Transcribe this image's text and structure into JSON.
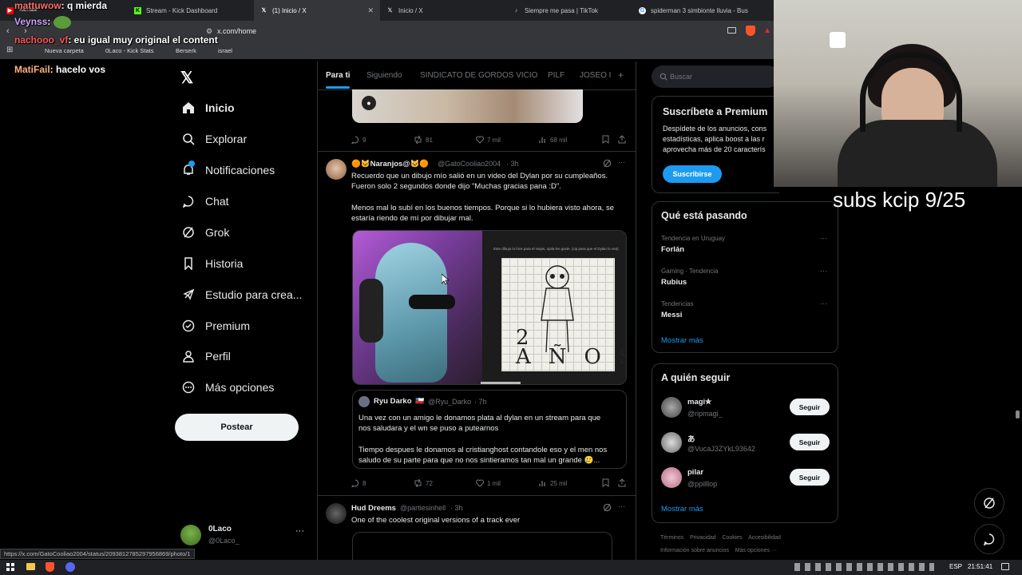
{
  "tabs": [
    {
      "label": "YouTube",
      "icon": "youtube-icon",
      "color": "#ff0000"
    },
    {
      "label": "Stream - Kick Dashboard",
      "icon": "kick-icon",
      "color": "#53fc18"
    },
    {
      "label": "(1) Inicio / X",
      "icon": "x-icon",
      "color": "#ffffff"
    },
    {
      "label": "Inicio / X",
      "icon": "x-icon",
      "color": "#ffffff"
    },
    {
      "label": "Siempre me pasa | TikTok",
      "icon": "tiktok-icon",
      "color": "#ffffff"
    },
    {
      "label": "spiderman 3 simbionte lluvia - Bus",
      "icon": "google-icon",
      "color": "#4285f4"
    }
  ],
  "address": {
    "url": "x.com/home"
  },
  "bookmarks": [
    "Nueva carpeta",
    "0Laco - Kick Stats",
    "Berserk",
    "israel"
  ],
  "chat": [
    {
      "user": "mattuwow",
      "text": ": q mierda"
    },
    {
      "user": "Veynss",
      "text": ":"
    },
    {
      "user": "nachooo_vf",
      "text": ": eu igual muy original el content"
    },
    {
      "user": "MatiFail",
      "text": ": hacelo vos"
    }
  ],
  "nav": {
    "items": [
      "Inicio",
      "Explorar",
      "Notificaciones",
      "Chat",
      "Grok",
      "Historia",
      "Estudio para crea...",
      "Premium",
      "Perfil",
      "Más opciones"
    ],
    "post": "Postear",
    "account_name": "0Laco",
    "account_handle": "@0Laco_",
    "status_url": "https://x.com/GatoCooliao2004/status/2093812785297956869/photo/1"
  },
  "feed": {
    "tabs": [
      "Para ti",
      "Siguiendo",
      "SINDICATO DE GORDOS VICIO",
      "PILF",
      "JOSEO I"
    ],
    "prev_actions": {
      "replies": "9",
      "reposts": "81",
      "likes": "7 mil",
      "views": "68 mil"
    },
    "post1": {
      "name": "🟠🐱Naranjos@🐱🟠",
      "handle": "@GatoCooliao2004",
      "time": "· 3h",
      "line1": "Recuerdo que un dibujo mío salió en un video del Dylan por su cumpleaños.",
      "line2": "Fueron solo 2 segundos donde dijo \"Muchas gracias pana :D\".",
      "line3": "Menos mal lo subí en los buenos tiempos. Porque si lo hubiera visto ahora, se",
      "line4": "estaría riendo de mí por dibujar mal.",
      "drawing_text": "2 AÑOS",
      "overlay_text": "Este dibujo lo hice para el viejas, ojala les guste. (Up para que el Dylan lo vea)",
      "quote": {
        "name": "Ryu Darko",
        "flag": "🇨🇱",
        "handle": "@Ryu_Darko",
        "time": "· 7h",
        "line1": "Una vez con un amigo le donamos plata al dylan en un stream para que",
        "line2": "nos saludara y el wn se puso a putearnos",
        "line3": "Tiempo despues le donamos al cristianghost contandole eso y el men nos",
        "line4": "saludo de su parte para que no nos sintieramos tan mal un grande 🥲..."
      },
      "actions": {
        "replies": "8",
        "reposts": "72",
        "likes": "1 mil",
        "views": "25 mil"
      }
    },
    "post2": {
      "name": "Hud Dreems",
      "handle": "@partiesinhell",
      "time": "· 3h",
      "text": "One of the coolest original versions of a track ever"
    }
  },
  "right": {
    "search_placeholder": "Buscar",
    "premium": {
      "title": "Suscríbete a Premium",
      "l1": "Despídete de los anuncios, cons",
      "l2": "estadísticas, aplica boost a las r",
      "l3": "aprovecha más de 20 caracterís",
      "button": "Suscribirse"
    },
    "trends_title": "Qué está pasando",
    "trends": [
      {
        "context": "Tendencia en Uruguay",
        "name": "Forlán"
      },
      {
        "context": "Gaming · Tendencia",
        "name": "Rubius"
      },
      {
        "context": "Tendencias",
        "name": "Messi"
      }
    ],
    "show_more": "Mostrar más",
    "follow_title": "A quién seguir",
    "who": [
      {
        "name": "magi✮",
        "handle": "@ripmagi_"
      },
      {
        "name": "あ",
        "handle": "@VucaJ3ZYkL93642"
      },
      {
        "name": "pilar",
        "handle": "@ppilllop"
      }
    ],
    "follow_label": "Seguir",
    "show_more2": "Mostrar más",
    "footer1": "Términos    Privacidad    Cookies    Accesibilidad",
    "footer2": "Información sobre anuncios    Más opciones ···"
  },
  "overlay_text": "subs kcip 9/25",
  "taskbar": {
    "lang": "ESP",
    "time": "21:51:41"
  },
  "colors": {
    "accent": "#1d9bf0",
    "bg": "#000000",
    "border": "#2f3336",
    "muted": "#71767b"
  }
}
